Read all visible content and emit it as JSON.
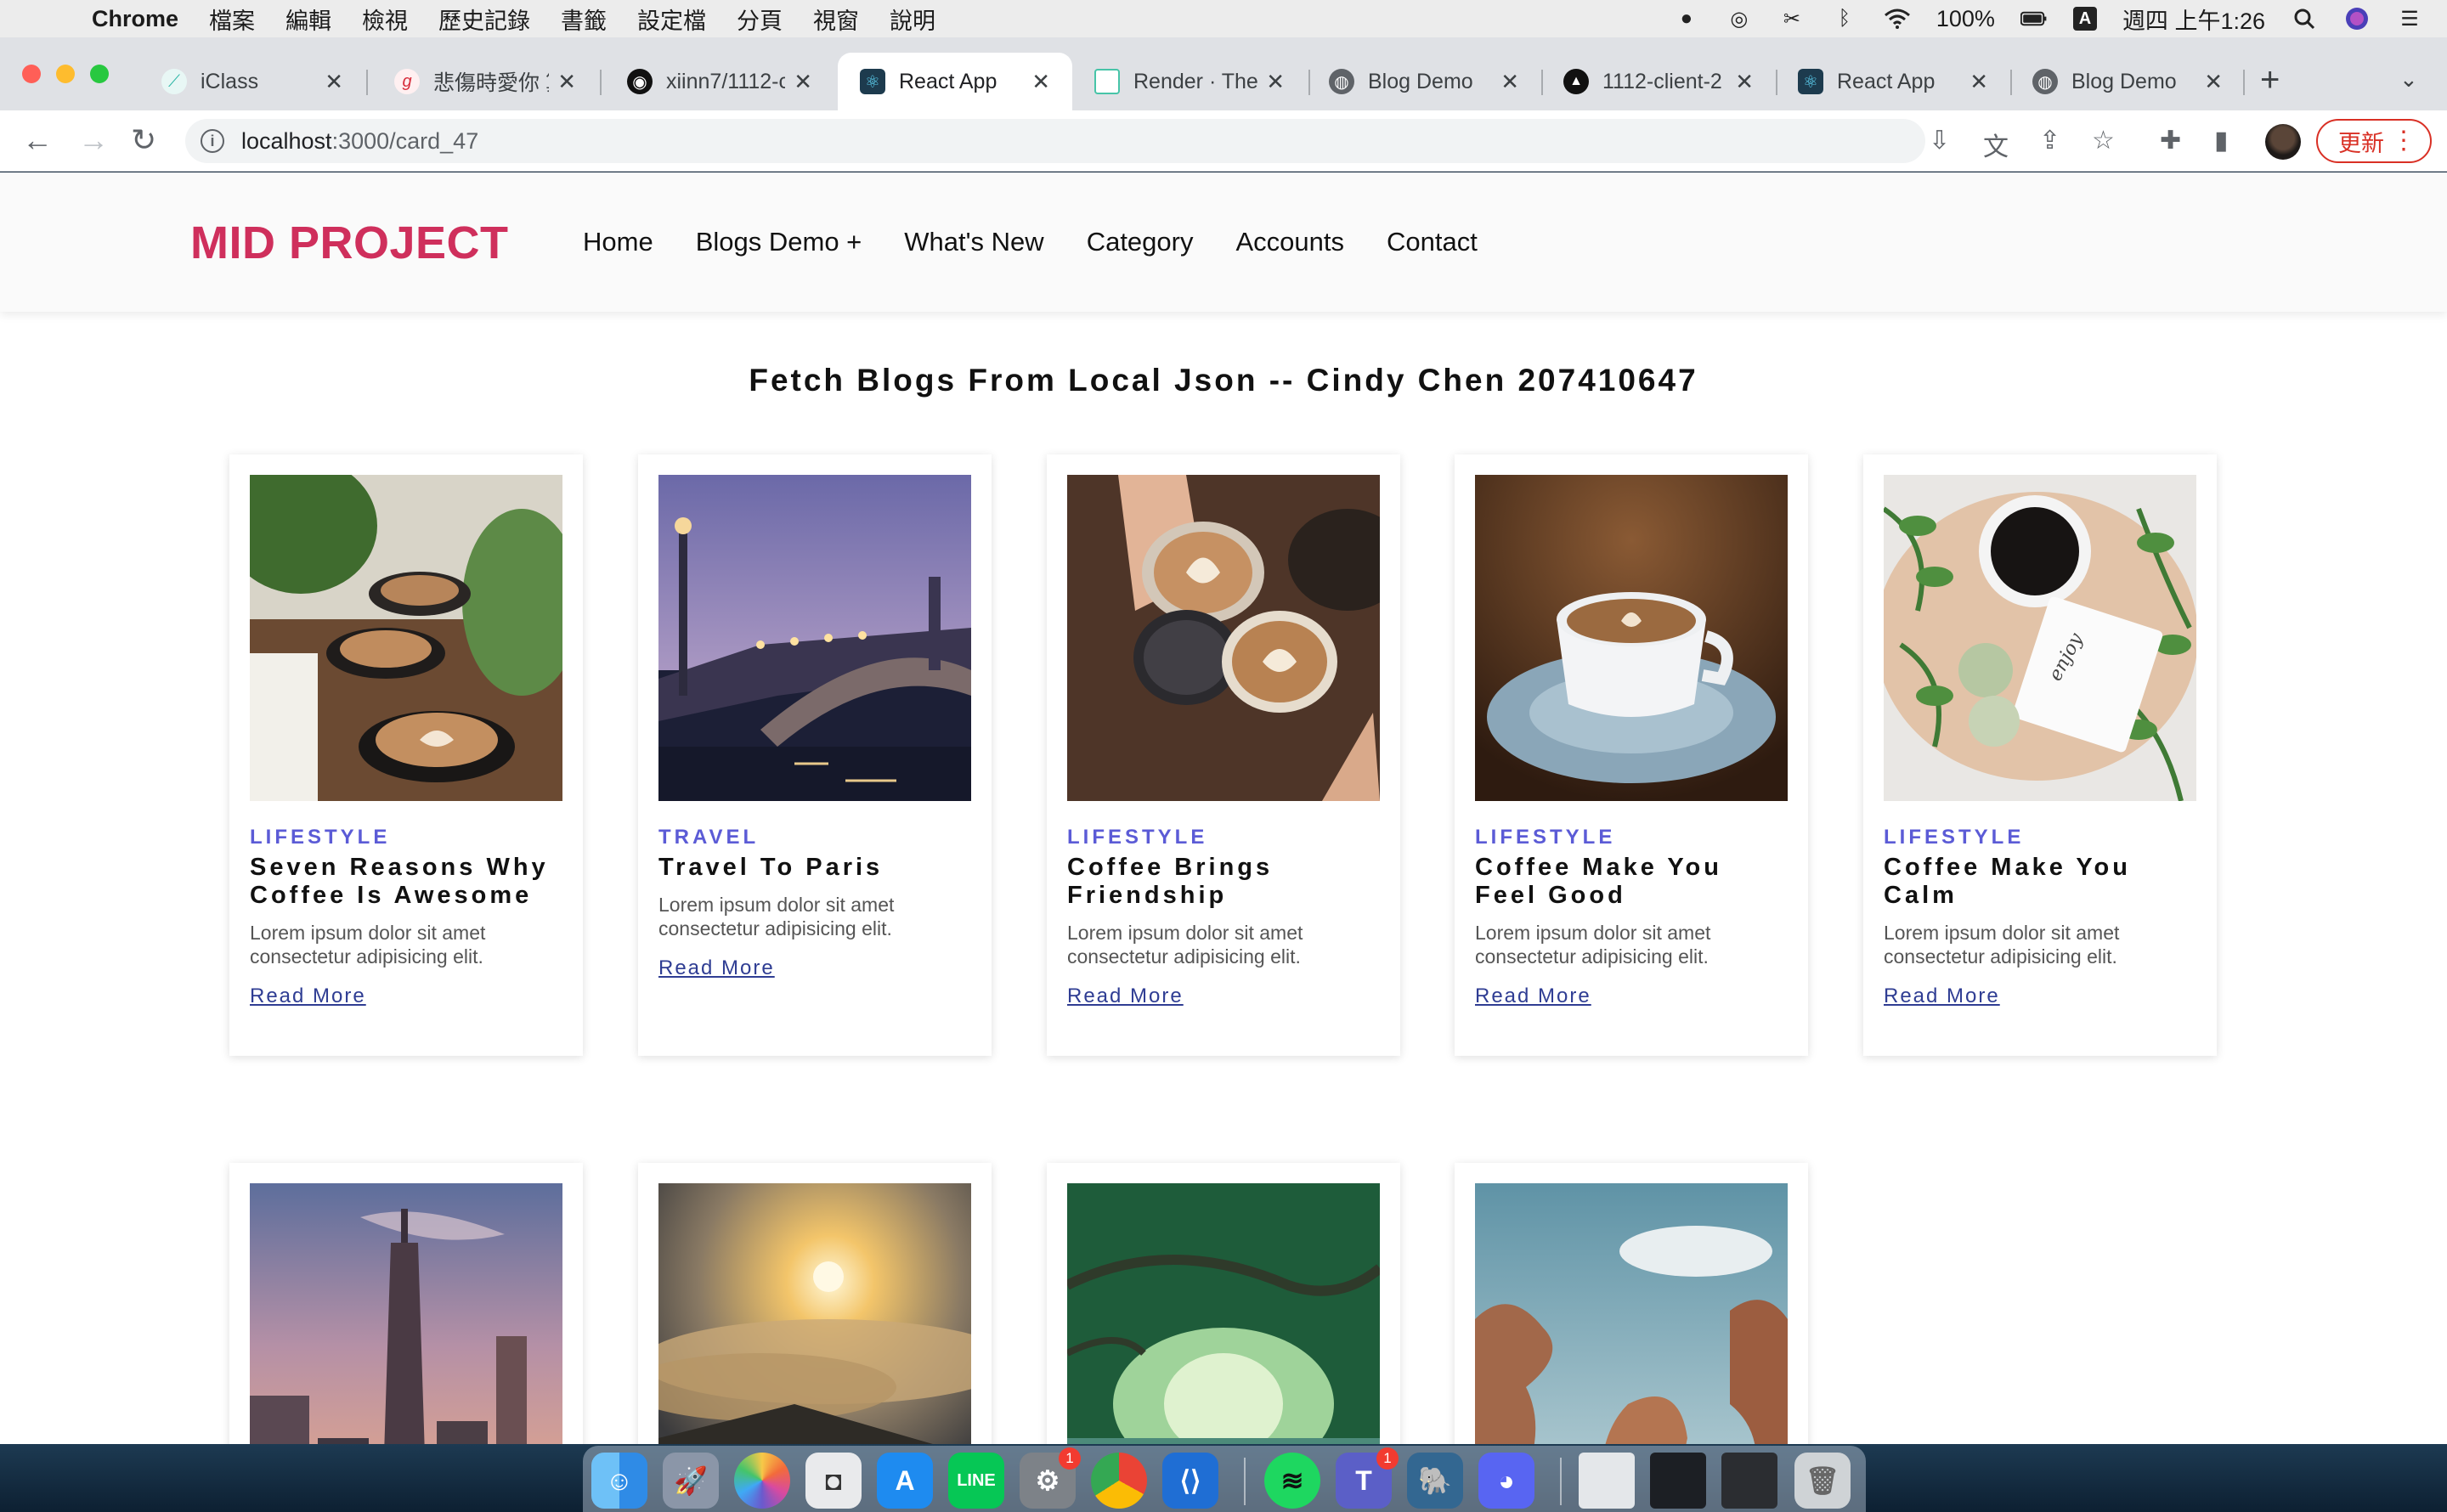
{
  "menubar": {
    "app": "Chrome",
    "items": [
      "檔案",
      "編輯",
      "檢視",
      "歷史記錄",
      "書籤",
      "設定檔",
      "分頁",
      "視窗",
      "說明"
    ],
    "battery": "100%",
    "input_method": "A",
    "clock": "週四 上午1:26"
  },
  "tabs": [
    {
      "title": "iClass",
      "icon": "iclass-icon",
      "color": "#2bb5a5"
    },
    {
      "title": "悲傷時愛你 算",
      "icon": "lyrics-site-icon",
      "color": "#d62b3a"
    },
    {
      "title": "xiinn7/1112-c",
      "icon": "github-icon",
      "color": "#111111"
    },
    {
      "title": "React App",
      "icon": "react-icon",
      "color": "#1d3b4e"
    },
    {
      "title": "Render · The",
      "icon": "render-icon",
      "color": "#47c4a8"
    },
    {
      "title": "Blog Demo",
      "icon": "globe-icon",
      "color": "#5f6368"
    },
    {
      "title": "1112-client-2",
      "icon": "vercel-icon",
      "color": "#111111"
    },
    {
      "title": "React App",
      "icon": "react-icon",
      "color": "#1d3b4e"
    },
    {
      "title": "Blog Demo",
      "icon": "globe-icon",
      "color": "#5f6368"
    }
  ],
  "address": {
    "host": "localhost",
    "path": ":3000/card_47"
  },
  "update_label": "更新",
  "site": {
    "brand": "MID PROJECT",
    "nav": [
      "Home",
      "Blogs Demo +",
      "What's New",
      "Category",
      "Accounts",
      "Contact"
    ],
    "heading": "Fetch Blogs From Local Json -- Cindy Chen 207410647"
  },
  "cards": [
    {
      "category": "LIFESTYLE",
      "title": "Seven Reasons Why Coffee Is Awesome",
      "desc": "Lorem ipsum dolor sit amet consectetur adipisicing elit.",
      "more": "Read More",
      "image": "latte-art-cups"
    },
    {
      "category": "TRAVEL",
      "title": "Travel To Paris",
      "desc": "Lorem ipsum dolor sit amet consectetur adipisicing elit.",
      "more": "Read More",
      "image": "paris-bridge-dusk"
    },
    {
      "category": "LIFESTYLE",
      "title": "Coffee Brings Friendship",
      "desc": "Lorem ipsum dolor sit amet consectetur adipisicing elit.",
      "more": "Read More",
      "image": "hands-holding-coffees"
    },
    {
      "category": "LIFESTYLE",
      "title": "Coffee Make You Feel Good",
      "desc": "Lorem ipsum dolor sit amet consectetur adipisicing elit.",
      "more": "Read More",
      "image": "coffee-cup-saucer"
    },
    {
      "category": "LIFESTYLE",
      "title": "Coffee Make You Calm",
      "desc": "Lorem ipsum dolor sit amet consectetur adipisicing elit.",
      "more": "Read More",
      "image": "coffee-with-plants"
    },
    {
      "image": "taipei-101-skyline"
    },
    {
      "image": "sunrise-over-clouds"
    },
    {
      "image": "mangrove-tunnel"
    },
    {
      "image": "sea-rock-formation"
    }
  ],
  "dock": {
    "badges": [
      "1",
      "1"
    ]
  }
}
